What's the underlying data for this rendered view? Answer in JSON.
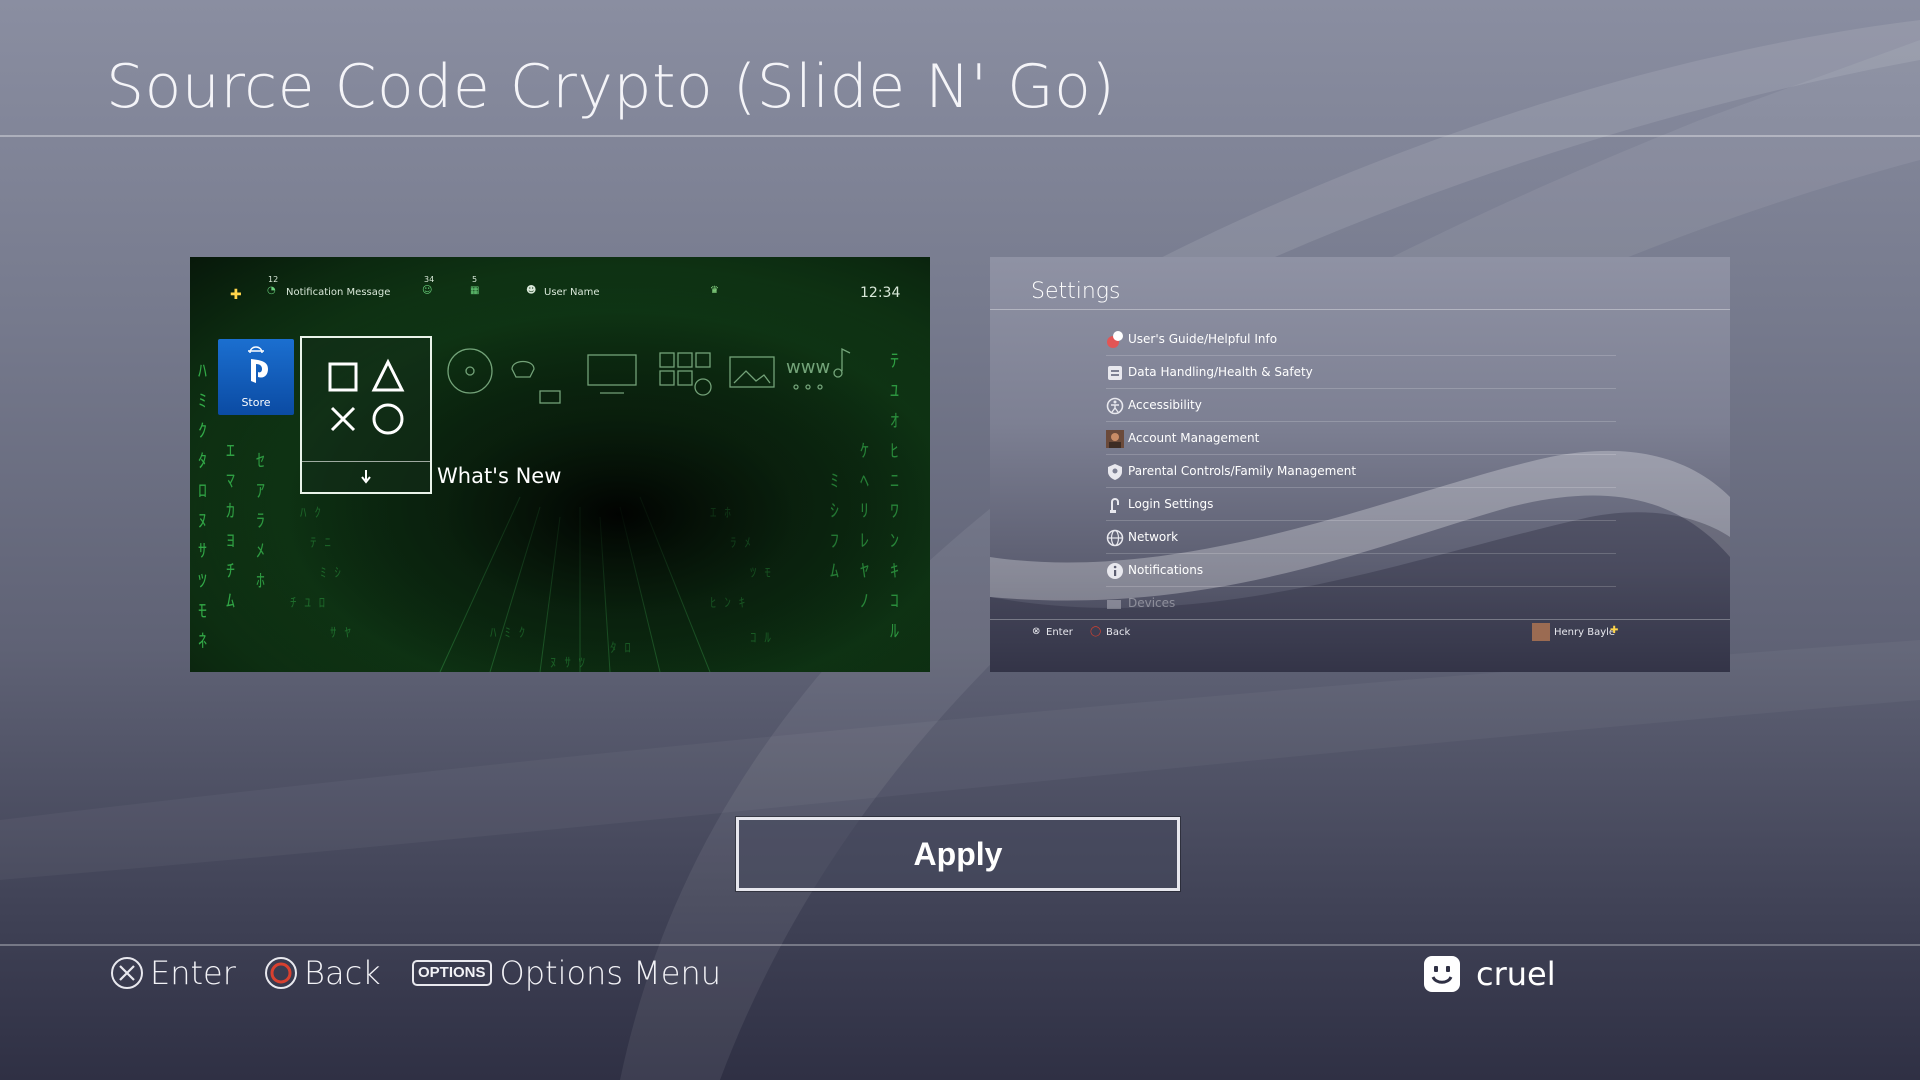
{
  "page": {
    "title": "Source Code Crypto (Slide N' Go)"
  },
  "home_preview": {
    "topbar": {
      "plus_icon": "ps-plus-icon",
      "notification_count": "12",
      "notification_label": "Notification Message",
      "friends_count": "34",
      "messages_count": "5",
      "user_label": "User Name",
      "time": "12:34"
    },
    "store_label": "Store",
    "whats_new_label": "What's New"
  },
  "settings_preview": {
    "title": "Settings",
    "items": [
      {
        "label": "User's Guide/Helpful Info",
        "icon": "help-icon"
      },
      {
        "label": "Data Handling/Health & Safety",
        "icon": "data-icon"
      },
      {
        "label": "Accessibility",
        "icon": "accessibility-icon"
      },
      {
        "label": "Account Management",
        "icon": "account-avatar-icon"
      },
      {
        "label": "Parental Controls/Family Management",
        "icon": "parental-icon"
      },
      {
        "label": "Login Settings",
        "icon": "login-icon"
      },
      {
        "label": "Network",
        "icon": "globe-icon"
      },
      {
        "label": "Notifications",
        "icon": "info-icon"
      },
      {
        "label": "Devices",
        "icon": "devices-icon"
      }
    ],
    "footer": {
      "enter_label": "Enter",
      "back_label": "Back",
      "user_name": "Henry Bayle"
    }
  },
  "apply_label": "Apply",
  "bottom_bar": {
    "enter_label": "Enter",
    "back_label": "Back",
    "options_chip": "OPTIONS",
    "options_label": "Options Menu",
    "user_name": "cruel"
  },
  "colors": {
    "matrix_green": "#3fd45a",
    "store_blue": "#0b4ba3",
    "circle_red": "#d8402f"
  }
}
